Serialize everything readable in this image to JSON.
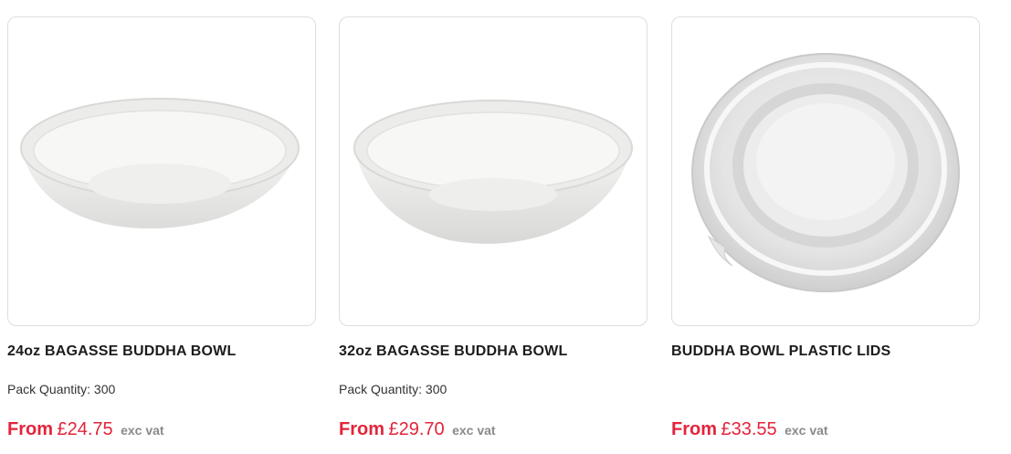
{
  "products": [
    {
      "image_icon": "bagasse-bowl-image",
      "title": "24oz BAGASSE BUDDHA BOWL",
      "pack_quantity": "Pack Quantity: 300",
      "price_prefix": "From",
      "price": "£24.75",
      "vat_note": "exc vat"
    },
    {
      "image_icon": "bagasse-bowl-image",
      "title": "32oz BAGASSE BUDDHA BOWL",
      "pack_quantity": "Pack Quantity: 300",
      "price_prefix": "From",
      "price": "£29.70",
      "vat_note": "exc vat"
    },
    {
      "image_icon": "plastic-lid-image",
      "title": "BUDDHA BOWL PLASTIC LIDS",
      "pack_quantity": "",
      "price_prefix": "From",
      "price": "£33.55",
      "vat_note": "exc vat"
    }
  ],
  "colors": {
    "price": "#e3243b",
    "vat": "#8a8a8a",
    "border": "#dedede"
  }
}
